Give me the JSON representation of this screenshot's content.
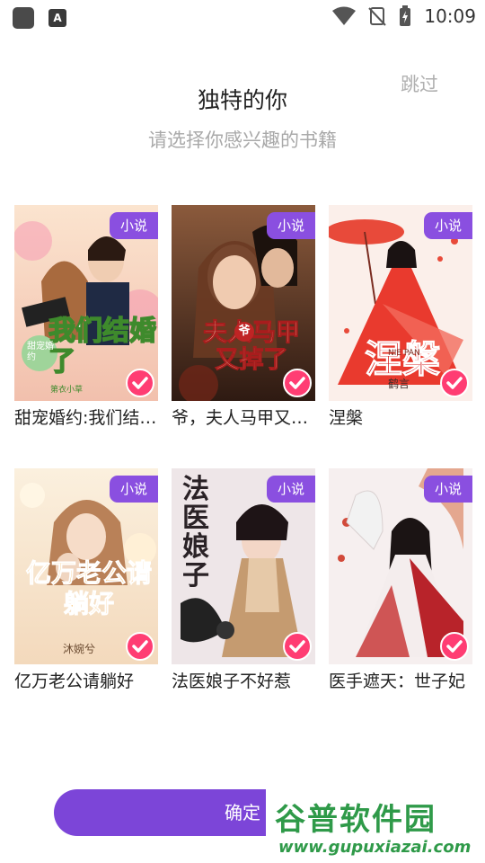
{
  "status_bar": {
    "time": "10:09",
    "app_icon": "app-notification-icon",
    "a_icon_letter": "A",
    "icons": [
      "wifi-icon",
      "no-signal-icon",
      "battery-charging-icon"
    ]
  },
  "header": {
    "skip_label": "跳过",
    "title": "独特的你",
    "subtitle": "请选择你感兴趣的书籍"
  },
  "books": [
    {
      "title": "甜宠婚约:我们结婚了",
      "badge": "小说",
      "selected": true,
      "cover_text": "我们结婚了",
      "cover_small": "甜宠婚约",
      "author": "第衣小草",
      "cover_colors": [
        "#f4d3b8",
        "#f0b9a8"
      ]
    },
    {
      "title": "爷，夫人马甲又掉了",
      "badge": "小说",
      "selected": true,
      "cover_text": "夫人马甲又掉了",
      "cover_small": "爷",
      "author": "",
      "cover_colors": [
        "#7a4a30",
        "#3a2418"
      ]
    },
    {
      "title": "涅槃",
      "badge": "小说",
      "selected": true,
      "cover_text": "涅槃",
      "cover_small": "NIE PAN",
      "author": "鹤言",
      "cover_colors": [
        "#fbe9e3",
        "#e95a4a"
      ]
    },
    {
      "title": "亿万老公请躺好",
      "badge": "小说",
      "selected": true,
      "cover_text": "亿万老公请躺好",
      "cover_small": "",
      "author": "沐婉兮",
      "cover_colors": [
        "#f9ecd9",
        "#f3d8b9"
      ]
    },
    {
      "title": "法医娘子不好惹",
      "badge": "小说",
      "selected": true,
      "cover_text": "法医娘子",
      "cover_small": "",
      "author": "",
      "cover_colors": [
        "#ece4e6",
        "#c9b9c4"
      ]
    },
    {
      "title": "医手遮天：世子妃",
      "badge": "小说",
      "selected": true,
      "cover_text": "",
      "cover_small": "",
      "author": "",
      "cover_colors": [
        "#f5eeee",
        "#d9c9cc"
      ]
    }
  ],
  "confirm_label": "确定",
  "watermark": {
    "text": "谷普软件园",
    "url": "www.gupuxiazai.com"
  },
  "colors": {
    "accent": "#7c45d8",
    "badge": "#8a4fe0",
    "check": "#ff3d73"
  }
}
